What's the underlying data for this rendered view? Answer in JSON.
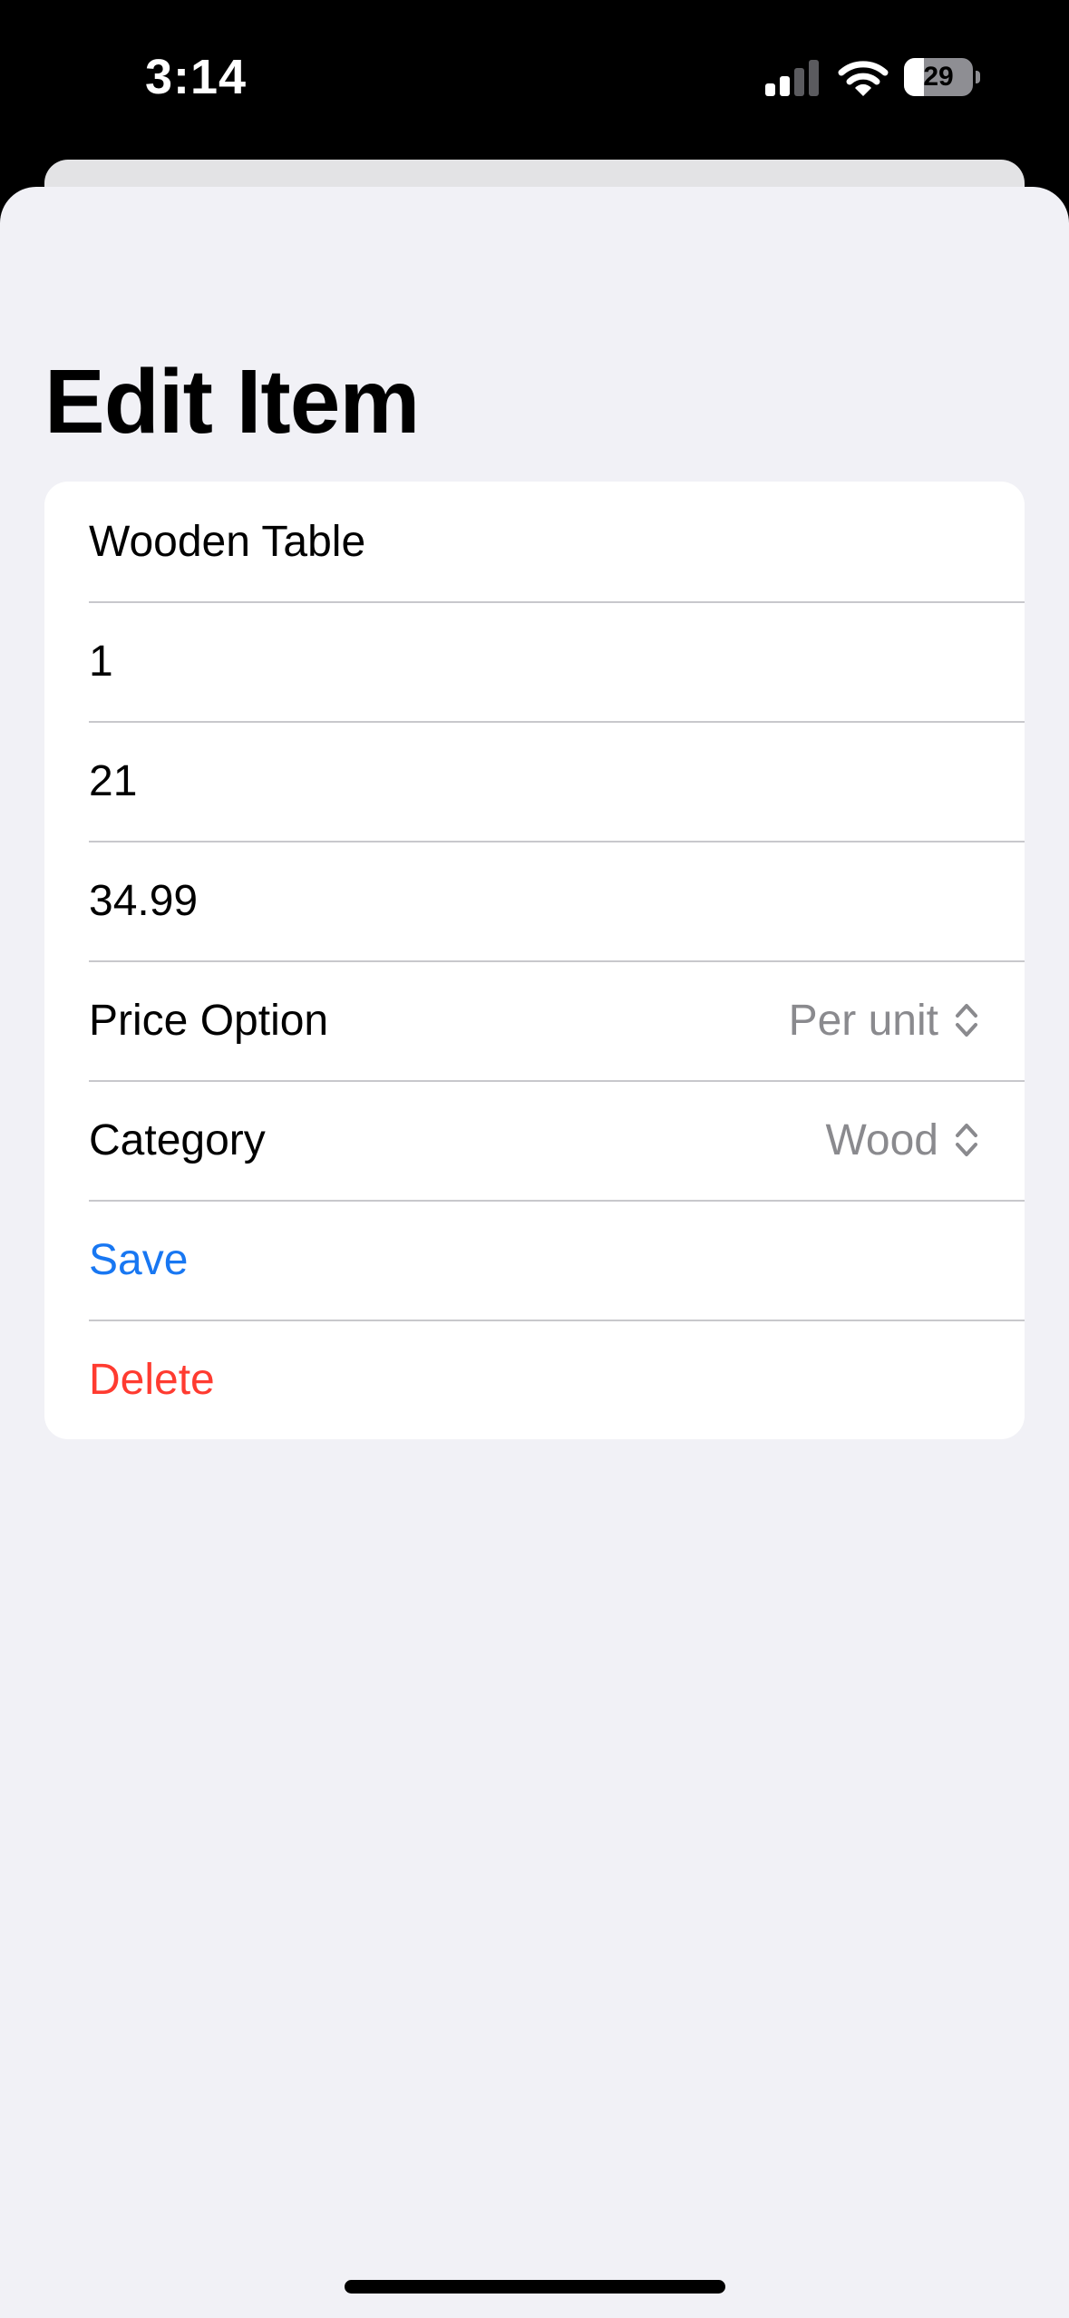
{
  "status_bar": {
    "time": "3:14",
    "battery_level": "29",
    "battery_fraction": 0.29,
    "signal_icon": "cellular-signal-icon",
    "wifi_icon": "wifi-icon"
  },
  "page": {
    "title": "Edit Item"
  },
  "form": {
    "name_value": "Wooden Table",
    "field2_value": "1",
    "field3_value": "21",
    "price_value": "34.99",
    "price_option": {
      "label": "Price Option",
      "selected": "Per unit",
      "icon": "chevron-updown-icon"
    },
    "category": {
      "label": "Category",
      "selected": "Wood",
      "icon": "chevron-updown-icon"
    },
    "save_label": "Save",
    "delete_label": "Delete"
  },
  "colors": {
    "accent": "#1877f2",
    "destructive": "#ff3b30",
    "background": "#f1f1f6",
    "secondary_text": "#8a8a8e"
  }
}
